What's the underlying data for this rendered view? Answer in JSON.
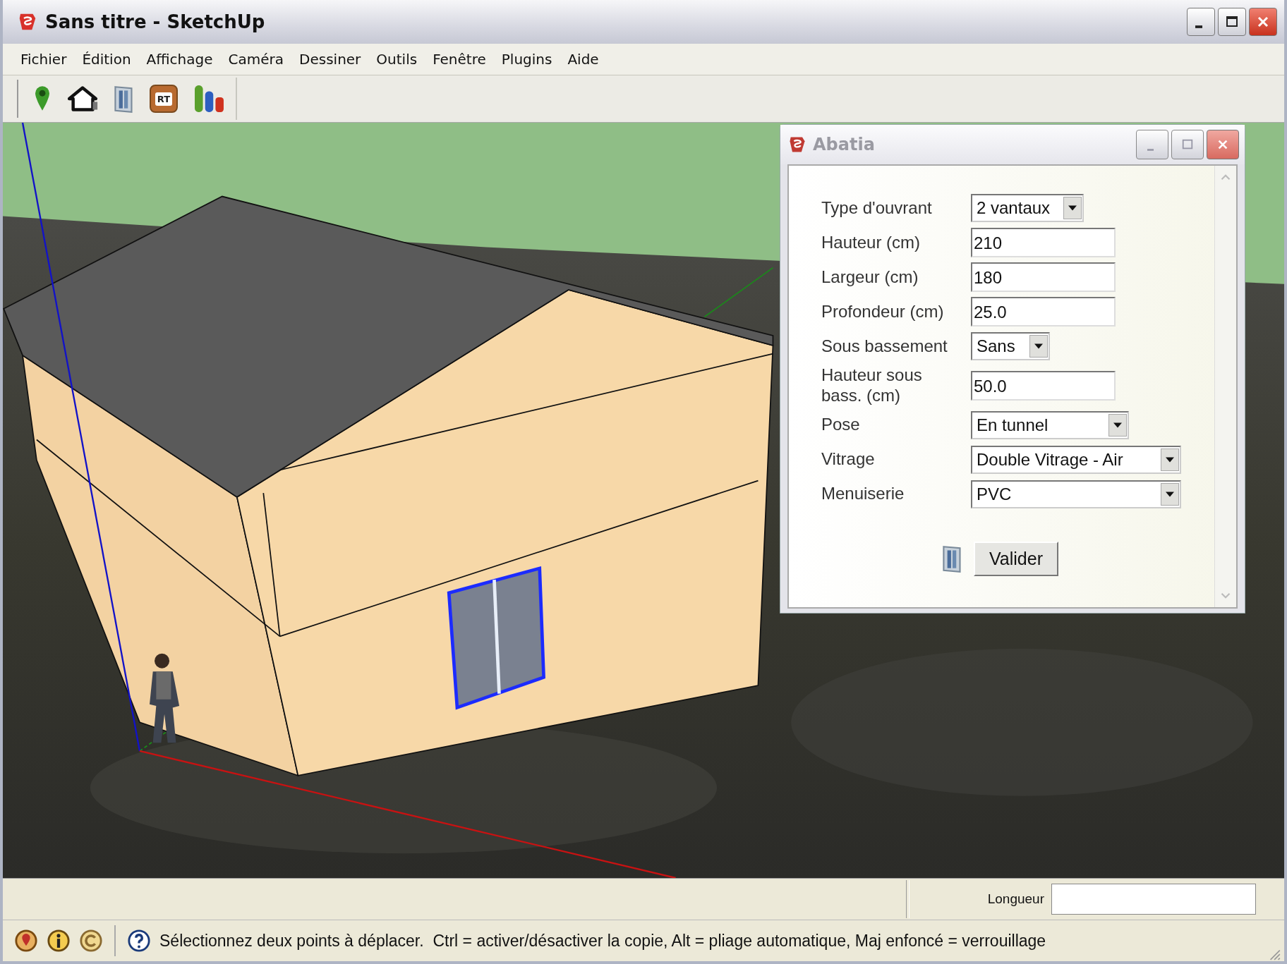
{
  "window": {
    "title": "Sans titre - SketchUp"
  },
  "menu": [
    "Fichier",
    "Édition",
    "Affichage",
    "Caméra",
    "Dessiner",
    "Outils",
    "Fenêtre",
    "Plugins",
    "Aide"
  ],
  "toolbar": [
    {
      "kind": "pin"
    },
    {
      "kind": "house"
    },
    {
      "kind": "window"
    },
    {
      "kind": "badge",
      "label": "RT"
    },
    {
      "kind": "bars"
    }
  ],
  "dialog": {
    "title": "Abatia",
    "fields": [
      {
        "label": "Type d'ouvrant",
        "kind": "select",
        "value": "2 vantaux"
      },
      {
        "label": "Hauteur (cm)",
        "kind": "text",
        "value": "210"
      },
      {
        "label": "Largeur (cm)",
        "kind": "text",
        "value": "180"
      },
      {
        "label": "Profondeur (cm)",
        "kind": "text",
        "value": "25.0"
      },
      {
        "label": "Sous bassement",
        "kind": "select",
        "value": "Sans"
      },
      {
        "label": "Hauteur sous bass. (cm)",
        "kind": "text",
        "value": "50.0"
      },
      {
        "label": "Pose",
        "kind": "select",
        "value": "En tunnel"
      },
      {
        "label": "Vitrage",
        "kind": "select",
        "value": "Double Vitrage - Air"
      },
      {
        "label": "Menuiserie",
        "kind": "select",
        "value": "PVC"
      }
    ],
    "button": "Valider"
  },
  "measurement": {
    "label": "Longueur"
  },
  "status_bar": {
    "text": "Sélectionnez deux points à déplacer.  Ctrl = activer/désactiver la copie, Alt = pliage automatique, Maj enfoncé = verrouillage"
  }
}
